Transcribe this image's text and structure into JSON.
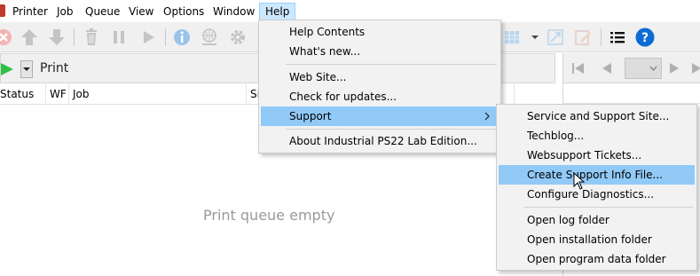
{
  "menubar": {
    "items": [
      {
        "label": "Printer"
      },
      {
        "label": "Job"
      },
      {
        "label": "Queue"
      },
      {
        "label": "View"
      },
      {
        "label": "Options"
      },
      {
        "label": "Window"
      },
      {
        "label": "Help"
      }
    ]
  },
  "toolbar": {
    "icons": [
      "cancel-icon",
      "move-up-icon",
      "move-down-icon",
      "delete-icon",
      "pause-icon",
      "play-icon",
      "info-icon",
      "network-icon",
      "settings-icon",
      "grid-view-icon",
      "resize-icon",
      "edit-icon",
      "list-icon",
      "help-icon"
    ],
    "help_glyph": "?"
  },
  "print_panel": {
    "label": "Print",
    "columns": [
      "Status",
      "WF",
      "Job",
      "Size"
    ],
    "empty_message": "Print queue empty"
  },
  "help_menu": {
    "items": [
      {
        "label": "Help Contents"
      },
      {
        "label": "What's new..."
      },
      {
        "label": "Web Site..."
      },
      {
        "label": "Check for updates..."
      },
      {
        "label": "Support"
      },
      {
        "label": "About Industrial PS22 Lab Edition..."
      }
    ]
  },
  "support_menu": {
    "items": [
      {
        "label": "Service and Support Site..."
      },
      {
        "label": "Techblog..."
      },
      {
        "label": "Websupport Tickets..."
      },
      {
        "label": "Create Support Info File..."
      },
      {
        "label": "Configure Diagnostics..."
      },
      {
        "label": "Open log folder"
      },
      {
        "label": "Open installation folder"
      },
      {
        "label": "Open program data folder"
      }
    ]
  },
  "colors": {
    "highlight": "#91c9f7",
    "menu_bg": "#f2f2f2",
    "active_menu": "#cce8ff",
    "accent_blue": "#0b6cd6"
  }
}
